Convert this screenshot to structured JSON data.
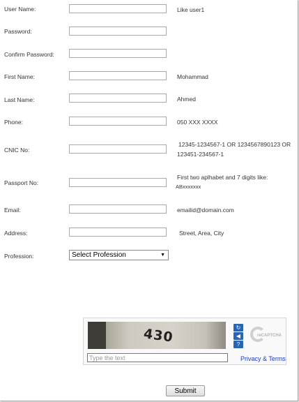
{
  "form": {
    "fields": [
      {
        "label": "User Name:",
        "hint": "Like user1"
      },
      {
        "label": "Password:",
        "hint": ""
      },
      {
        "label": "Confirm Password:",
        "hint": ""
      },
      {
        "label": "First Name:",
        "hint": "Mohammad"
      },
      {
        "label": "Last Name:",
        "hint": "Ahmed"
      },
      {
        "label": "Phone:",
        "hint": "050 XXX XXXX"
      },
      {
        "label": "CNIC No:",
        "hint_line1": "12345-1234567-1 OR 1234567890123 OR",
        "hint_line2": "123451-234567-1"
      },
      {
        "label": "Passport No:",
        "hint_line1": "First two aplhabet and 7 digits like:",
        "hint_line2": "ABxxxxxxx"
      },
      {
        "label": "Email:",
        "hint": "emailid@domain.com"
      },
      {
        "label": "Address:",
        "hint": "Street, Area, City"
      }
    ],
    "profession": {
      "label": "Profession:",
      "selected": "Select Profession"
    },
    "submit_label": "Submit"
  },
  "captcha": {
    "challenge_text": "430",
    "input_placeholder": "Type the text",
    "privacy_link": "Privacy & Terms",
    "logo_text": "reCAPTCHA",
    "icons": [
      "refresh-icon",
      "audio-icon",
      "help-icon"
    ]
  }
}
